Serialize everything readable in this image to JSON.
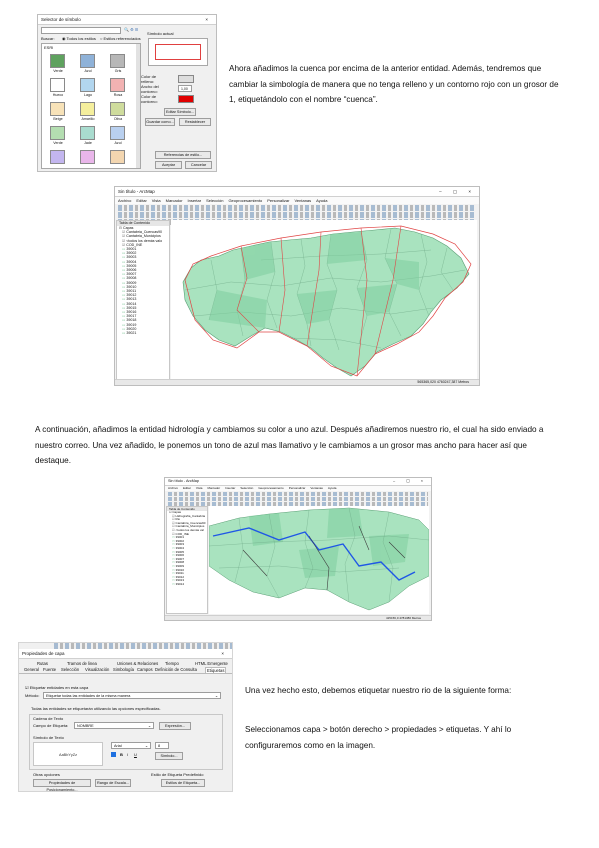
{
  "paragraphs": {
    "p1": "Ahora añadimos la cuenca por encima de la anterior entidad. Además, tendremos que cambiar la simbología de manera que no tenga relleno y un contorno rojo con un grosor de 1, etiquetándolo con el nombre “cuenca”.",
    "p2": "A continuación, añadimos la entidad hidrología y cambiamos su color a uno azul. Después añadiremos nuestro rio, el cual ha sido enviado a nuestro correo. Una vez añadido, le ponemos un tono de azul mas llamativo y le cambiamos a un grosor mas ancho para hacer así que destaque.",
    "p3a": "Una vez hecho esto, debemos etiquetar nuestro rio de la siguiente forma:",
    "p3b": "Seleccionamos capa > botón derecho > propiedades > etiquetas. Y ahí lo configuraremos como en la imagen."
  },
  "symbol_selector": {
    "title": "Selector de símbolo",
    "close": "×",
    "search_label": "Buscar:",
    "radio_all": "Todos los estilos",
    "radio_ref": "Estilos referenciados",
    "category": "ESRI",
    "current_label": "Símbolo actual",
    "fill_color_label": "Color de relleno:",
    "outline_width_label": "Ancho del contorno:",
    "outline_width_value": "1,00",
    "outline_color_label": "Color de contorno:",
    "edit_symbol_button": "Editar Símbolo...",
    "save_as_button": "Guardar como...",
    "reset_button": "Restablecer",
    "style_refs_button": "Referencias de estilo...",
    "accept_button": "Aceptar",
    "cancel_button": "Cancelar",
    "swatches": [
      {
        "label": "Verde",
        "color": "#5fa25f"
      },
      {
        "label": "Azul",
        "color": "#8fb2d8"
      },
      {
        "label": "Gris",
        "color": "#b7b7b7"
      },
      {
        "label": "Hueco",
        "color": "#ffffff"
      },
      {
        "label": "Lago",
        "color": "#b2d6ef"
      },
      {
        "label": "Rosa",
        "color": "#f2b2b2"
      },
      {
        "label": "Beige",
        "color": "#f7e2b8"
      },
      {
        "label": "Amarillo",
        "color": "#f5ef9d"
      },
      {
        "label": "Oliva",
        "color": "#cfdc9d"
      },
      {
        "label": "Verde",
        "color": "#b4deb1"
      },
      {
        "label": "Jade",
        "color": "#a9dccf"
      },
      {
        "label": "Azul",
        "color": "#b9d0ef"
      },
      {
        "label": "",
        "color": "#c3b6ef"
      },
      {
        "label": "",
        "color": "#e9b6ea"
      },
      {
        "label": "",
        "color": "#f3d6b0"
      }
    ],
    "current_outline_color": "#e04040",
    "outline_swatch_color": "#e00000"
  },
  "arcmap1": {
    "title": "Sin título - ArcMap",
    "window_controls": "–  ▢  ×",
    "menus": [
      "Archivo",
      "Editar",
      "Vista",
      "Marcador",
      "Insertar",
      "Selección",
      "Geoprocesamiento",
      "Personalizar",
      "Ventanas",
      "Ayuda"
    ],
    "toc_title": "Tabla de Contenido",
    "toc_items": [
      "Capas",
      "Cantabria_Cuencas90",
      "Cantabria_Municipios",
      "<todos los demás valo",
      "COD_INE",
      "39001",
      "39002",
      "39003",
      "39004",
      "39005",
      "39006",
      "39007",
      "39008",
      "39009",
      "39010",
      "39011",
      "39012",
      "39013",
      "39014",
      "39015",
      "39016",
      "39017",
      "39018",
      "39019",
      "39020",
      "39021"
    ],
    "status": "565365,020  4760247,387 Metros",
    "map_fill": "#a9e3bf",
    "outline_color": "#e04545"
  },
  "arcmap2": {
    "title": "Sin título - ArcMap",
    "menus": [
      "Archivo",
      "Editar",
      "Vista",
      "Marcador",
      "Insertar",
      "Selección",
      "Geoprocesamiento",
      "Personalizar",
      "Ventanas",
      "Ayuda"
    ],
    "toc_title": "Tabla de Contenido",
    "toc_items": [
      "Capas",
      "Hidrografía_Cantabria",
      "Rio",
      "Cantabria_Cuencas90",
      "Cantabria_Municipios",
      "<todos los demás val",
      "COD_INE",
      "39001",
      "39002",
      "39003",
      "39004",
      "39005",
      "39006",
      "39007",
      "39008",
      "39009",
      "39010",
      "39011",
      "39012",
      "39013",
      "39014"
    ],
    "status": "415156,0  4781380 Metros",
    "river_color": "#1f57e6"
  },
  "layer_props": {
    "title": "Propiedades de capa",
    "close": "×",
    "tabs_row1": [
      "Rutas",
      "Tramos de linea",
      "Uniones & Relaciones",
      "Tiempo",
      "HTML Emergente"
    ],
    "tabs_row2": [
      "General",
      "Fuente",
      "Selección",
      "Visualización",
      "Simbología",
      "Campos",
      "Definición de Consulta",
      "Etiquetas"
    ],
    "checkbox_label": "Etiquetar entidades en esta capa",
    "method_label": "Método:",
    "method_value": "Etiquetar todas las entidades de la misma manera",
    "info_text": "Todas las entidades se etiquetarán utilizando las opciones especificadas.",
    "text_string_label": "Cadena de Texto",
    "label_field_label": "Campo de Etiqueta:",
    "label_field_value": "NOMBRE",
    "expression_button": "Expresión...",
    "text_symbol_label": "Símbolo de Texto",
    "sample_text": "AaBbYyZz",
    "font_value": "Arial",
    "font_size_value": "8",
    "bold": "B",
    "italic": "I",
    "underline": "U",
    "symbol_button": "Símbolo...",
    "other_options_label": "Otras opciones",
    "placement_button": "Propiedades de Posicionamiento...",
    "scale_range_button": "Rango de Escala...",
    "predefined_label": "Estilo de Etiqueta Predefinido",
    "label_styles_button": "Estilos de Etiqueta..."
  }
}
